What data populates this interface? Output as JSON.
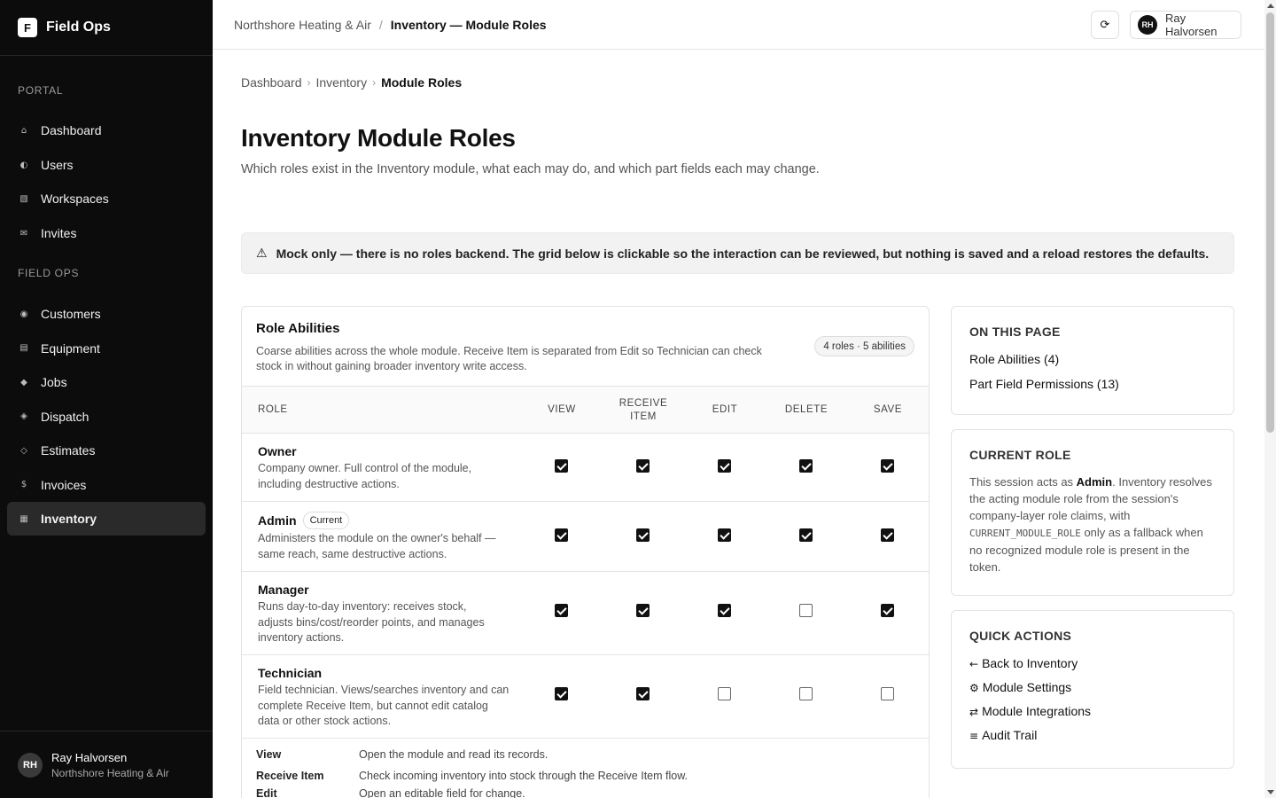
{
  "brand": {
    "initial": "F",
    "name": "Field Ops"
  },
  "sidebar": {
    "sections": [
      {
        "label": "PORTAL",
        "items": [
          {
            "label": "Dashboard",
            "icon": "home-icon",
            "glyph": "⌂"
          },
          {
            "label": "Users",
            "icon": "users-icon",
            "glyph": "◐"
          },
          {
            "label": "Workspaces",
            "icon": "workspaces-icon",
            "glyph": "▧"
          },
          {
            "label": "Invites",
            "icon": "mail-icon",
            "glyph": "✉"
          }
        ]
      },
      {
        "label": "FIELD OPS",
        "items": [
          {
            "label": "Customers",
            "icon": "customers-icon",
            "glyph": "◉"
          },
          {
            "label": "Equipment",
            "icon": "equipment-icon",
            "glyph": "▤"
          },
          {
            "label": "Jobs",
            "icon": "jobs-icon",
            "glyph": "◆"
          },
          {
            "label": "Dispatch",
            "icon": "dispatch-icon",
            "glyph": "◈"
          },
          {
            "label": "Estimates",
            "icon": "estimates-icon",
            "glyph": "◇"
          },
          {
            "label": "Invoices",
            "icon": "invoices-icon",
            "glyph": "$"
          },
          {
            "label": "Inventory",
            "icon": "inventory-icon",
            "glyph": "▦",
            "active": true
          }
        ]
      }
    ],
    "user": {
      "initials": "RH",
      "name": "Ray Halvorsen",
      "org": "Northshore Heating & Air"
    }
  },
  "topbar": {
    "org": "Northshore Heating & Air",
    "separator": "/",
    "page": "Inventory — Module Roles",
    "user_initials": "RH",
    "user_name": "Ray Halvorsen"
  },
  "breadcrumb": [
    "Dashboard",
    "Inventory",
    "Module Roles"
  ],
  "page": {
    "title": "Inventory Module Roles",
    "subtitle": "Which roles exist in the Inventory module, what each may do, and which part fields each may change."
  },
  "notice": "Mock only — there is no roles backend. The grid below is clickable so the interaction can be reviewed, but nothing is saved and a reload restores the defaults.",
  "abilities_card": {
    "title": "Role Abilities",
    "description": "Coarse abilities across the whole module. Receive Item is separated from Edit so Technician can check stock in without gaining broader inventory write access.",
    "badge": "4 roles · 5 abilities",
    "role_header": "ROLE",
    "columns": [
      "VIEW",
      "RECEIVE ITEM",
      "EDIT",
      "DELETE",
      "SAVE"
    ],
    "rows": [
      {
        "name": "Owner",
        "current": false,
        "description": "Company owner. Full control of the module, including destructive actions.",
        "abilities": [
          true,
          true,
          true,
          true,
          true
        ]
      },
      {
        "name": "Admin",
        "current": true,
        "current_label": "Current",
        "description": "Administers the module on the owner's behalf — same reach, same destructive actions.",
        "abilities": [
          true,
          true,
          true,
          true,
          true
        ]
      },
      {
        "name": "Manager",
        "current": false,
        "description": "Runs day-to-day inventory: receives stock, adjusts bins/cost/reorder points, and manages inventory actions.",
        "abilities": [
          true,
          true,
          true,
          false,
          true
        ]
      },
      {
        "name": "Technician",
        "current": false,
        "description": "Field technician. Views/searches inventory and can complete Receive Item, but cannot edit catalog data or other stock actions.",
        "abilities": [
          true,
          true,
          false,
          false,
          false
        ]
      }
    ],
    "legend": [
      {
        "term": "View",
        "definition": "Open the module and read its records."
      },
      {
        "term": "Receive Item",
        "definition": "Check incoming inventory into stock through the Receive Item flow."
      },
      {
        "term": "Edit",
        "definition": "Open an editable field for change."
      }
    ]
  },
  "on_this_page": {
    "title": "ON THIS PAGE",
    "links": [
      "Role Abilities (4)",
      "Part Field Permissions (13)"
    ]
  },
  "current_role": {
    "title": "CURRENT ROLE",
    "text_1": "This session acts as ",
    "role": "Admin",
    "text_2": ". Inventory resolves the acting module role from the session's company-layer role claims, with ",
    "code": "CURRENT_MODULE_ROLE",
    "text_3": " only as a fallback when no recognized module role is present in the token."
  },
  "quick_actions": {
    "title": "QUICK ACTIONS",
    "items": [
      {
        "glyph": "←",
        "label": "Back to Inventory",
        "icon": "arrow-left-icon"
      },
      {
        "glyph": "⚙",
        "label": "Module Settings",
        "icon": "gear-icon"
      },
      {
        "glyph": "⇄",
        "label": "Module Integrations",
        "icon": "swap-icon"
      },
      {
        "glyph": "≡",
        "label": "Audit Trail",
        "icon": "list-icon"
      }
    ]
  }
}
